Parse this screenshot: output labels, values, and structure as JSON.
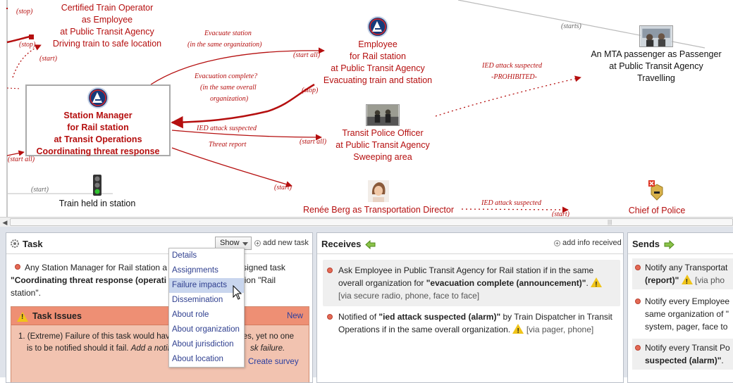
{
  "diagram": {
    "nodes": {
      "train_operator": [
        "Certified Train Operator",
        "as Employee",
        "at Public Transit Agency",
        "Driving train to safe location"
      ],
      "employee": [
        "Employee",
        "for Rail station",
        "at Public Transit Agency",
        "Evacuating train and station"
      ],
      "passenger": [
        "An MTA passenger as Passenger",
        "at Public Transit Agency",
        "Travelling"
      ],
      "station_manager": [
        "Station Manager",
        "for Rail station",
        "at Transit Operations",
        "Coordinating threat response"
      ],
      "police_officer": [
        "Transit Police Officer",
        "at Public Transit Agency",
        "Sweeping area"
      ],
      "train_held": [
        "Train held in station"
      ],
      "renee": [
        "Renée Berg as Transportation Director"
      ],
      "chief": [
        "Chief of Police"
      ]
    },
    "edge_labels": {
      "stop1": "(stop)",
      "stop2": "(stop)",
      "start1": "(start)",
      "evacuate_station": "Evacuate station",
      "same_org": "(in the same organization)",
      "start_all1": "(start all)",
      "evac_complete": "Evacuation complete?",
      "same_overall": "(in the same overall",
      "organization": "organization)",
      "stop3": "(stop)",
      "ied1": "IED attack suspected",
      "threat_report": "Threat report",
      "start_all2": "(start all)",
      "start_all3": "(start all)",
      "start2": "(start)",
      "start3": "(start)",
      "ied_prohibited": "IED attack suspected",
      "prohibited": "-PROHIBITED-",
      "starts": "(starts)",
      "ied3": "IED attack suspected",
      "start4": "(start)"
    }
  },
  "task_panel": {
    "title": "Task",
    "show_label": "Show",
    "add_task": "add new task",
    "desc_pre": "Any Station Manager for Rail station a",
    "desc_mid": "s is assigned task",
    "desc_bold": "\"Coordinating threat response (operati",
    "desc_post": "at location \"Rail",
    "desc_end": "station\".",
    "issues_title": "Task Issues",
    "issues_new": "New",
    "issue_line1": "1. (Extreme) Failure of this task would hav",
    "issue_line1b": "es, yet no one",
    "issue_line2a": "is to be notified should it fail.",
    "issue_line2b": "Add a notific",
    "issue_line2c": "sk failure.",
    "create_survey": "Create survey",
    "menu": [
      "Details",
      "Assignments",
      "Failure impacts",
      "Dissemination",
      "About role",
      "About organization",
      "About jurisdiction",
      "About location"
    ]
  },
  "receives_panel": {
    "title": "Receives",
    "add_info": "add info received",
    "msg1_a": "Ask Employee in Public Transit Agency for Rail station if in the same",
    "msg1_b": "overall organization for ",
    "msg1_bold": "\"evacuation complete (announcement)\"",
    "msg1_c": ".",
    "msg1_via": "[via secure radio, phone, face to face]",
    "msg2_a": "Notified of ",
    "msg2_bold": "\"ied attack suspected (alarm)\"",
    "msg2_b": " by Train Dispatcher in Transit",
    "msg2_c": "Operations if in the same overall organization.",
    "msg2_via": "[via pager, phone]"
  },
  "sends_panel": {
    "title": "Sends",
    "s1_a": "Notify any Transportat",
    "s1_bold": "(report)\"",
    "s1_via": "[via pho",
    "s2_a": "Notify every Employee",
    "s2_b": "same organization of \"",
    "s2_c": "system, pager, face to",
    "s3_a": "Notify every Transit Po",
    "s3_bold": "suspected (alarm)\"",
    "s3_c": "."
  },
  "colors": {
    "accent_red": "#b50f0f",
    "link_blue": "#2f3f8f",
    "issue_bg": "#f2c3b0"
  }
}
